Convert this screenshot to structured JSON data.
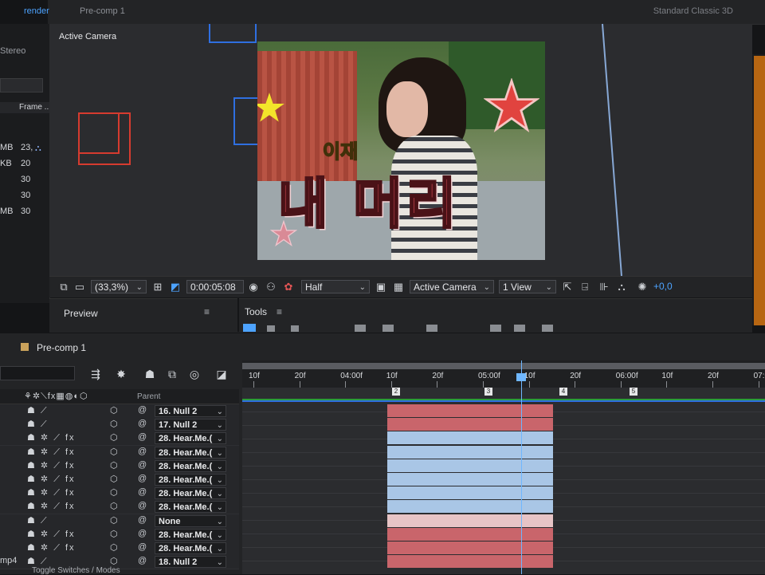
{
  "top_tabs": {
    "active": "render",
    "precomp": "Pre-comp 1",
    "right": "Standard  Classic 3D"
  },
  "project": {
    "stereo_label": "Stereo",
    "frame_header": "Frame ...",
    "rows": [
      {
        "size": "MB",
        "rate": "23,"
      },
      {
        "size": "KB",
        "rate": "20"
      },
      {
        "size": "",
        "rate": "30"
      },
      {
        "size": "",
        "rate": "30"
      },
      {
        "size": "MB",
        "rate": "30"
      }
    ]
  },
  "viewer": {
    "label": "Active Camera",
    "caption_small": "이재",
    "caption_big": "내 머리"
  },
  "toolbar": {
    "zoom": "(33,3%)",
    "timecode": "0:00:05:08",
    "resolution": "Half",
    "camera": "Active Camera",
    "views": "1 View",
    "exposure": "+0,0"
  },
  "panels": {
    "preview": "Preview",
    "tools": "Tools"
  },
  "timeline": {
    "comp_name": "Pre-comp 1",
    "parent_header": "Parent",
    "footer": "Toggle Switches / Modes",
    "row_prefix": "mp4",
    "ruler_labels": [
      "10f",
      "20f",
      "04:00f",
      "10f",
      "20f",
      "05:00f",
      "10f",
      "20f",
      "06:00f",
      "10f",
      "20f",
      "07:0"
    ],
    "markers": [
      "2",
      "3",
      "4",
      "5"
    ],
    "layers": [
      {
        "parent": "16. Null 2",
        "fx": false,
        "bar": "red"
      },
      {
        "parent": "17. Null 2",
        "fx": false,
        "bar": "red"
      },
      {
        "parent": "28. Hear.Me.(",
        "fx": true,
        "bar": "blue"
      },
      {
        "parent": "28. Hear.Me.(",
        "fx": true,
        "bar": "blue"
      },
      {
        "parent": "28. Hear.Me.(",
        "fx": true,
        "bar": "blue"
      },
      {
        "parent": "28. Hear.Me.(",
        "fx": true,
        "bar": "blue"
      },
      {
        "parent": "28. Hear.Me.(",
        "fx": true,
        "bar": "blue"
      },
      {
        "parent": "28. Hear.Me.(",
        "fx": true,
        "bar": "blue"
      },
      {
        "parent": "None",
        "fx": false,
        "bar": "pink"
      },
      {
        "parent": "28. Hear.Me.(",
        "fx": true,
        "bar": "red"
      },
      {
        "parent": "28. Hear.Me.(",
        "fx": true,
        "bar": "red"
      },
      {
        "parent": "18. Null 2",
        "fx": false,
        "bar": "red"
      }
    ]
  },
  "colors": {
    "accent": "#4da3ff",
    "red_bar": "#c9656b",
    "blue_bar": "#a9c6e6",
    "pink_bar": "#e7c4c6",
    "guide_red": "#d63b2f",
    "guide_blue": "#2f6fe0"
  }
}
